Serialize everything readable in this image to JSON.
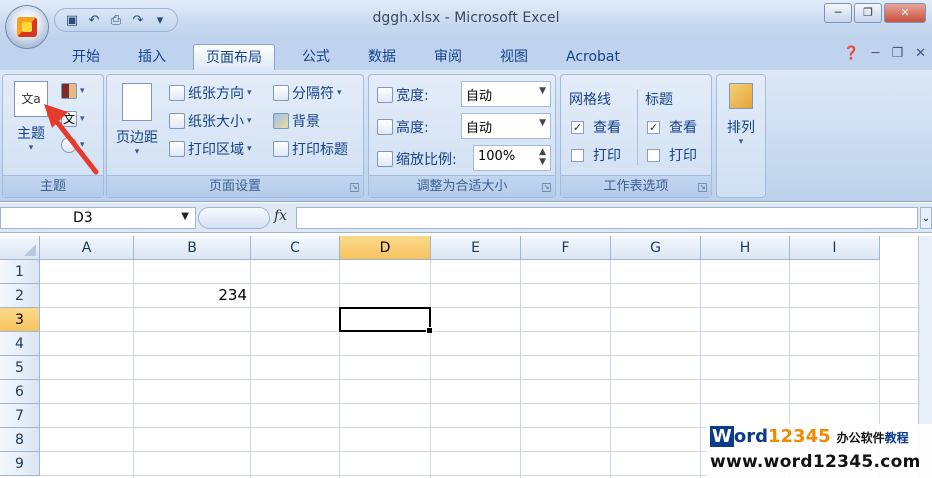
{
  "window": {
    "title": "dggh.xlsx - Microsoft Excel"
  },
  "tabs": [
    {
      "label": "开始",
      "active": false
    },
    {
      "label": "插入",
      "active": false
    },
    {
      "label": "页面布局",
      "active": true
    },
    {
      "label": "公式",
      "active": false
    },
    {
      "label": "数据",
      "active": false
    },
    {
      "label": "审阅",
      "active": false
    },
    {
      "label": "视图",
      "active": false
    },
    {
      "label": "Acrobat",
      "active": false
    }
  ],
  "ribbon": {
    "themes": {
      "label": "主题",
      "themes_button": "主题",
      "colors_glyph": "■",
      "fonts_glyph": "文",
      "effects_glyph": "◯"
    },
    "page_setup": {
      "label": "页面设置",
      "margins": "页边距",
      "orientation": "纸张方向",
      "size": "纸张大小",
      "print_area": "打印区域",
      "breaks": "分隔符",
      "background": "背景",
      "print_titles": "打印标题"
    },
    "scale_to_fit": {
      "label": "调整为合适大小",
      "width_label": "宽度:",
      "width_value": "自动",
      "height_label": "高度:",
      "height_value": "自动",
      "scale_label": "缩放比例:",
      "scale_value": "100%"
    },
    "sheet_options": {
      "label": "工作表选项",
      "gridlines": "网格线",
      "headings": "标题",
      "view": "查看",
      "print": "打印",
      "gridlines_view_checked": true,
      "gridlines_print_checked": false,
      "headings_view_checked": true,
      "headings_print_checked": false
    },
    "arrange": {
      "label": "排列"
    }
  },
  "formula_bar": {
    "name_box": "D3",
    "fx": "fx",
    "content": ""
  },
  "sheet": {
    "columns": [
      "A",
      "B",
      "C",
      "D",
      "E",
      "F",
      "G",
      "H",
      "I"
    ],
    "rows": [
      "1",
      "2",
      "3",
      "4",
      "5",
      "6",
      "7",
      "8",
      "9"
    ],
    "selected_column": "D",
    "selected_row": "3",
    "cells": {
      "B2": "234"
    }
  },
  "watermark": {
    "brand_w": "W",
    "brand_ord": "ord",
    "brand_num": "12345",
    "tagline_a": "办公软件",
    "tagline_b": "教程",
    "url": "www.word12345.com"
  },
  "colors": {
    "selected_header": "#f7c35f",
    "annotation_arrow": "#e53b2c"
  }
}
